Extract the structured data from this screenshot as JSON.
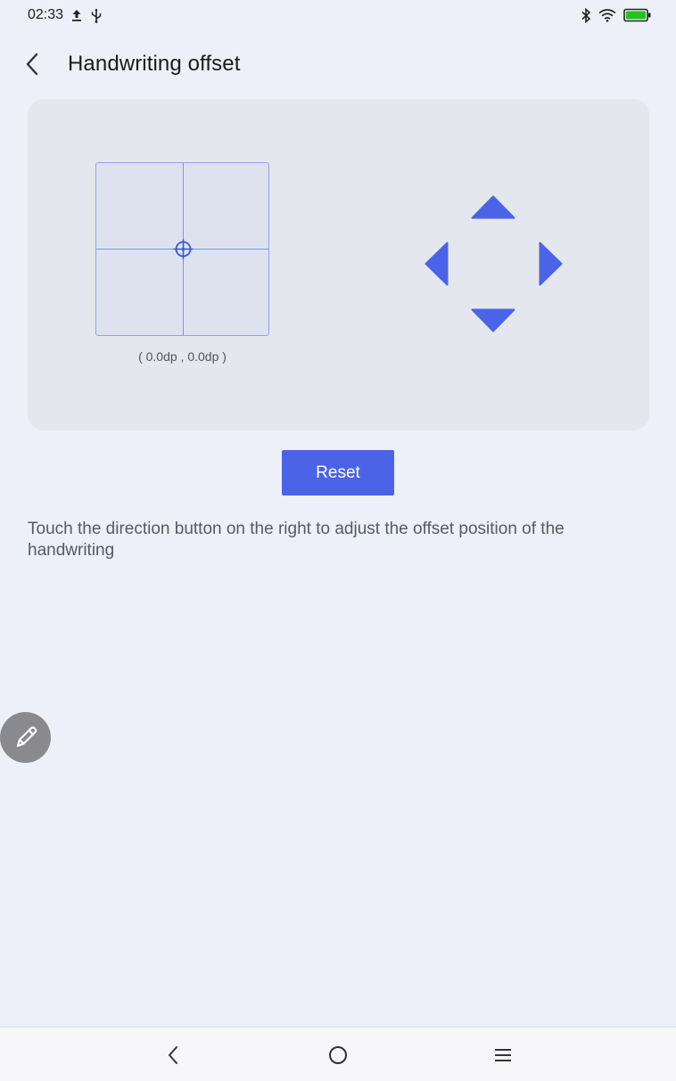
{
  "status_bar": {
    "time": "02:33",
    "icons_left": [
      "upload-icon",
      "usb-icon"
    ],
    "icons_right": [
      "bluetooth-icon",
      "wifi-icon",
      "battery-icon"
    ],
    "battery_color": "#21c41d"
  },
  "header": {
    "title": "Handwriting offset",
    "back_icon": "chevron-left-icon"
  },
  "offset_panel": {
    "coordinates": "( 0.0dp , 0.0dp )",
    "grid_color": "#7d93e8"
  },
  "dpad": {
    "directions": [
      "up",
      "left",
      "right",
      "down"
    ],
    "color": "#4a63e7"
  },
  "actions": {
    "reset_label": "Reset"
  },
  "instructions": "Touch the direction button on the right to adjust the offset position of the handwriting",
  "floating_button": {
    "icon": "pen-icon"
  },
  "nav_bar": {
    "icons": [
      "nav-back-icon",
      "nav-home-icon",
      "nav-menu-icon"
    ]
  },
  "colors": {
    "accent": "#4a63e7",
    "background": "#edf0f8",
    "panel": "#e5e7ee"
  }
}
